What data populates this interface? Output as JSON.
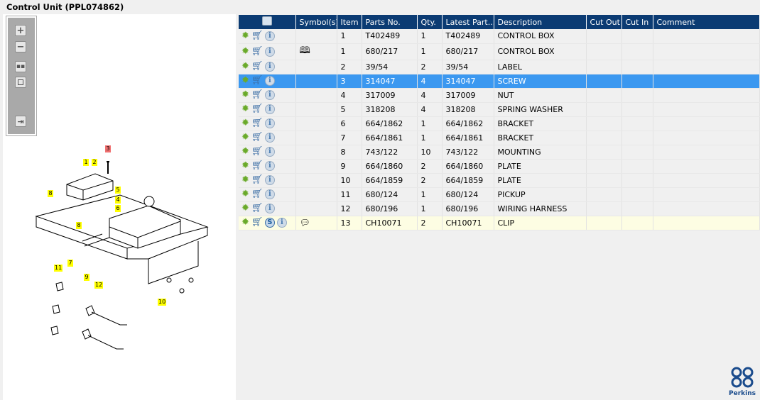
{
  "title": "Control Unit (PPL074862)",
  "toolbar": {
    "zoom_in": "+",
    "zoom_out": "−"
  },
  "callouts": [
    {
      "label": "3",
      "red": true
    },
    {
      "label": "1"
    },
    {
      "label": "2"
    },
    {
      "label": "8"
    },
    {
      "label": "5"
    },
    {
      "label": "4"
    },
    {
      "label": "6"
    },
    {
      "label": "8"
    },
    {
      "label": "7"
    },
    {
      "label": "9"
    },
    {
      "label": "11"
    },
    {
      "label": "12"
    },
    {
      "label": "10"
    }
  ],
  "table": {
    "headers": [
      "",
      "Symbol(s)",
      "Item",
      "Parts No.",
      "Qty.",
      "Latest Part...",
      "Description",
      "Cut Out",
      "Cut In",
      "Comment"
    ],
    "rows": [
      {
        "item": "1",
        "part": "T402489",
        "qty": "1",
        "latest": "T402489",
        "desc": "CONTROL BOX"
      },
      {
        "item": "1",
        "part": "680/217",
        "qty": "1",
        "latest": "680/217",
        "desc": "CONTROL BOX",
        "symbol": "book-icon"
      },
      {
        "item": "2",
        "part": "39/54",
        "qty": "2",
        "latest": "39/54",
        "desc": "LABEL"
      },
      {
        "item": "3",
        "part": "314047",
        "qty": "4",
        "latest": "314047",
        "desc": "SCREW",
        "selected": true
      },
      {
        "item": "4",
        "part": "317009",
        "qty": "4",
        "latest": "317009",
        "desc": "NUT"
      },
      {
        "item": "5",
        "part": "318208",
        "qty": "4",
        "latest": "318208",
        "desc": "SPRING WASHER"
      },
      {
        "item": "6",
        "part": "664/1862",
        "qty": "1",
        "latest": "664/1862",
        "desc": "BRACKET"
      },
      {
        "item": "7",
        "part": "664/1861",
        "qty": "1",
        "latest": "664/1861",
        "desc": "BRACKET"
      },
      {
        "item": "8",
        "part": "743/122",
        "qty": "10",
        "latest": "743/122",
        "desc": "MOUNTING"
      },
      {
        "item": "9",
        "part": "664/1860",
        "qty": "2",
        "latest": "664/1860",
        "desc": "PLATE"
      },
      {
        "item": "10",
        "part": "664/1859",
        "qty": "2",
        "latest": "664/1859",
        "desc": "PLATE"
      },
      {
        "item": "11",
        "part": "680/124",
        "qty": "1",
        "latest": "680/124",
        "desc": "PICKUP"
      },
      {
        "item": "12",
        "part": "680/196",
        "qty": "1",
        "latest": "680/196",
        "desc": "WIRING HARNESS"
      },
      {
        "item": "13",
        "part": "CH10071",
        "qty": "2",
        "latest": "CH10071",
        "desc": "CLIP",
        "symbol": "exclamation-bubble-icon",
        "s_badge": "S",
        "warn": true
      }
    ]
  },
  "brand": "Perkins",
  "colors": {
    "header": "#0b3b73",
    "selected": "#3b98f0",
    "warn": "#fdfde3"
  }
}
